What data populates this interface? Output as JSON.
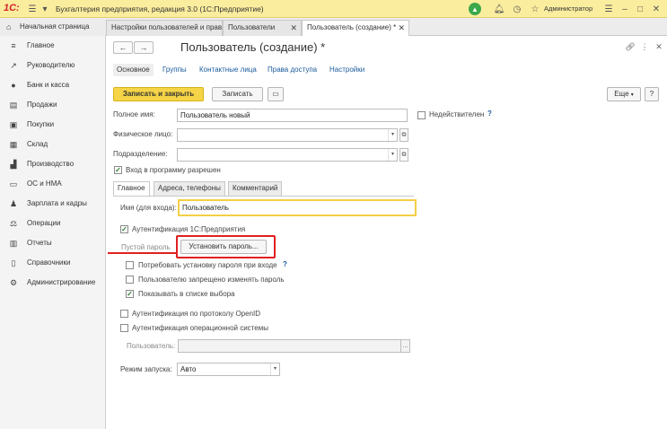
{
  "titlebar": {
    "logo": "1С:",
    "title": "Бухгалтерия предприятия, редакция 3.0  (1С:Предприятие)",
    "user": "Администратор"
  },
  "tabs": [
    {
      "label": "Начальная страница"
    },
    {
      "label": "Настройки пользователей и прав"
    },
    {
      "label": "Пользователи"
    },
    {
      "label": "Пользователь (создание) *"
    }
  ],
  "sidebar": {
    "items": [
      {
        "label": "Главное",
        "icon": "menu-icon"
      },
      {
        "label": "Руководителю",
        "icon": "chart-icon"
      },
      {
        "label": "Банк и касса",
        "icon": "coin-icon"
      },
      {
        "label": "Продажи",
        "icon": "cart-icon"
      },
      {
        "label": "Покупки",
        "icon": "bag-icon"
      },
      {
        "label": "Склад",
        "icon": "warehouse-icon"
      },
      {
        "label": "Производство",
        "icon": "factory-icon"
      },
      {
        "label": "ОС и НМА",
        "icon": "building-icon"
      },
      {
        "label": "Зарплата и кадры",
        "icon": "people-icon"
      },
      {
        "label": "Операции",
        "icon": "operations-icon"
      },
      {
        "label": "Отчеты",
        "icon": "report-icon"
      },
      {
        "label": "Справочники",
        "icon": "book-icon"
      },
      {
        "label": "Администрирование",
        "icon": "gear-icon"
      }
    ]
  },
  "form": {
    "title": "Пользователь (создание) *",
    "nav_tabs": [
      {
        "label": "Основное"
      },
      {
        "label": "Группы"
      },
      {
        "label": "Контактные лица"
      },
      {
        "label": "Права доступа"
      },
      {
        "label": "Настройки"
      }
    ],
    "toolbar": {
      "save_close": "Записать и закрыть",
      "save": "Записать",
      "more": "Еще"
    },
    "full_name": {
      "label": "Полное имя:",
      "value": "Пользователь новый"
    },
    "inactive": {
      "label": "Недействителен",
      "checked": false
    },
    "individual": {
      "label": "Физическое лицо:",
      "value": ""
    },
    "department": {
      "label": "Подразделение:",
      "value": ""
    },
    "login_allowed": {
      "label": "Вход в программу разрешен",
      "checked": true
    },
    "page_tabs": [
      {
        "label": "Главное"
      },
      {
        "label": "Адреса, телефоны"
      },
      {
        "label": "Комментарий"
      }
    ],
    "login_name": {
      "label": "Имя (для входа):",
      "value": "Пользователь"
    },
    "auth_1c": {
      "label": "Аутентификация 1С:Предприятия",
      "checked": true
    },
    "empty_password": "Пустой пароль",
    "set_password": "Установить пароль...",
    "require_password_change": {
      "label": "Потребовать установку пароля при входе",
      "checked": false
    },
    "forbid_password_change": {
      "label": "Пользователю запрещено изменять пароль",
      "checked": false
    },
    "show_in_list": {
      "label": "Показывать в списке выбора",
      "checked": true
    },
    "auth_openid": {
      "label": "Аутентификация по протоколу OpenID",
      "checked": false
    },
    "auth_os": {
      "label": "Аутентификация операционной системы",
      "checked": false
    },
    "os_user": {
      "label": "Пользователь:",
      "value": ""
    },
    "launch_mode": {
      "label": "Режим запуска:",
      "value": "Авто"
    }
  }
}
